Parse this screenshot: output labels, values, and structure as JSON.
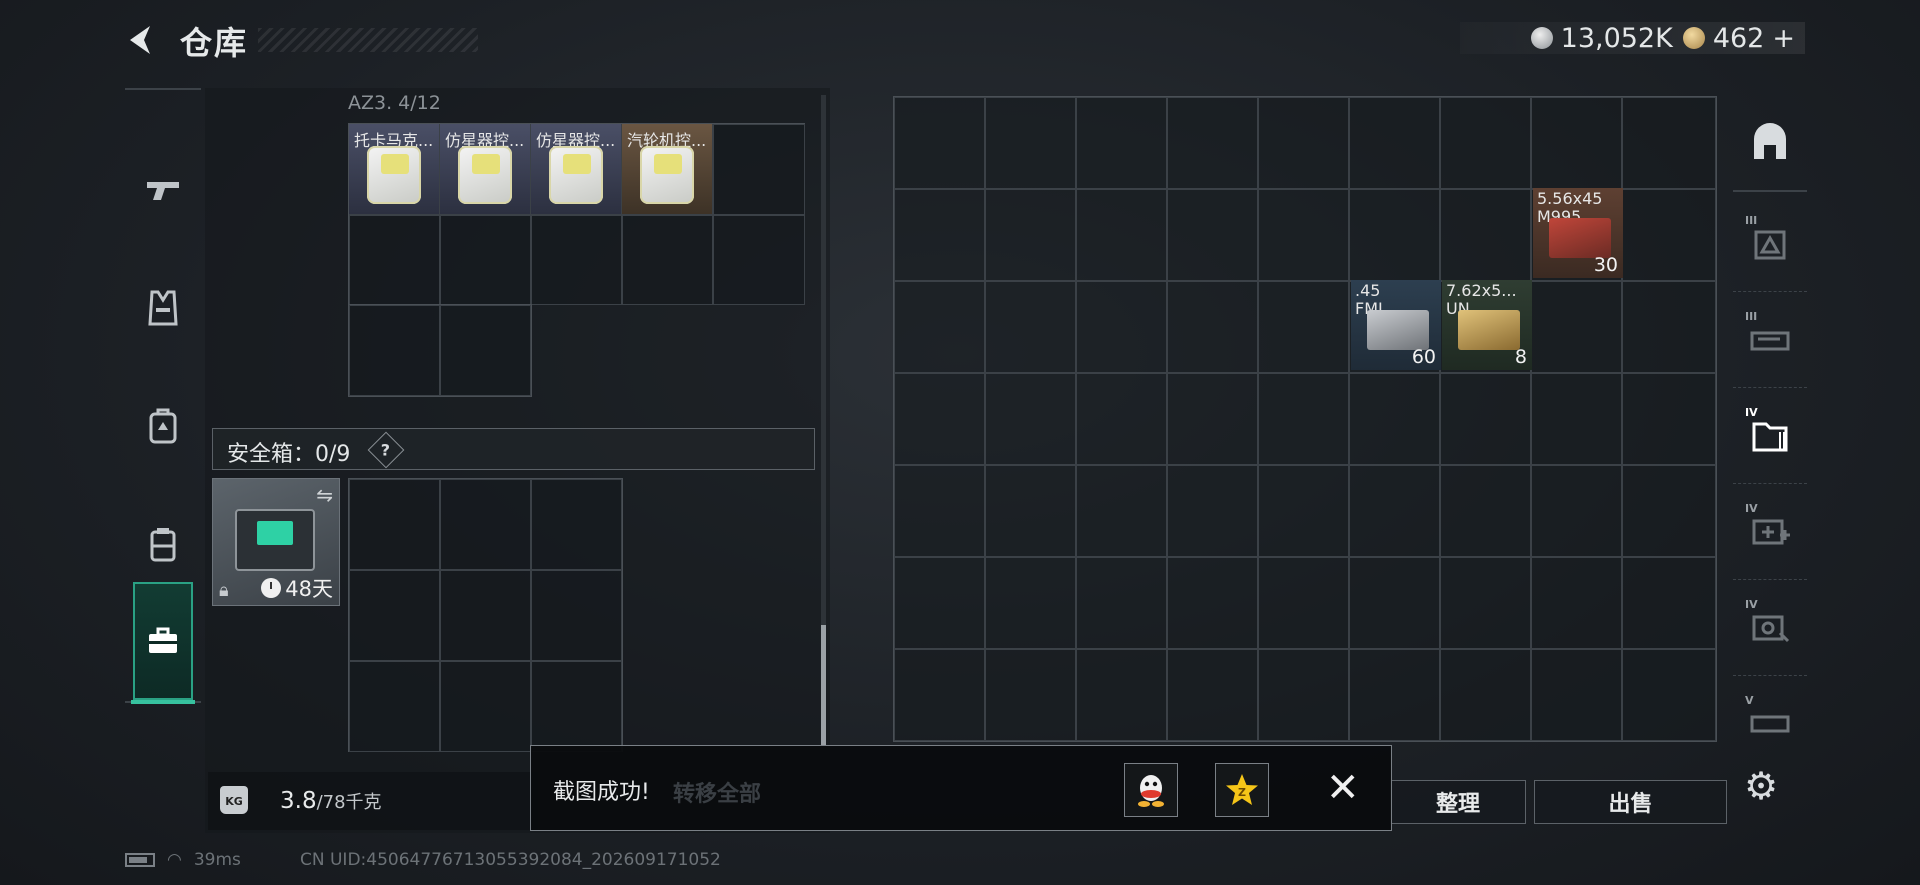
{
  "header": {
    "title": "仓库",
    "currency_primary": "13,052K",
    "currency_secondary": "462",
    "add_symbol": "+"
  },
  "sidebar": {
    "items": [
      {
        "icon": "pistol-icon"
      },
      {
        "icon": "vest-icon"
      },
      {
        "icon": "backpack-icon"
      },
      {
        "icon": "rig-icon"
      },
      {
        "icon": "briefcase-icon",
        "active": true
      }
    ]
  },
  "container": {
    "label": "AZ3. 4/12",
    "items": [
      "托卡马克...",
      "仿星器控...",
      "仿星器控...",
      "汽轮机控..."
    ]
  },
  "safe_box": {
    "label": "安全箱：0/9",
    "help": "?",
    "days": "48天"
  },
  "weight": {
    "current": "3.8",
    "max": "/78千克",
    "icon_text": "KG"
  },
  "stash": {
    "items": [
      {
        "name_line1": "5.56x45",
        "name_line2": "M995",
        "count": "30"
      },
      {
        "name_line1": ".45",
        "name_line2": "FMJ",
        "count": "60"
      },
      {
        "name_line1": "7.62x5...",
        "name_line2": "UN",
        "count": "8"
      }
    ]
  },
  "buttons": {
    "tidy": "整理",
    "sell": "出售",
    "transfer_all": "转移全部"
  },
  "right_bar": {
    "tiers": [
      "",
      "III",
      "III",
      "IV",
      "IV",
      "IV",
      "V"
    ]
  },
  "toast": {
    "message": "截图成功!",
    "close": "✕"
  },
  "status": {
    "ping": "39ms",
    "uid": "CN UID:45064776713055392084_202609171052"
  }
}
